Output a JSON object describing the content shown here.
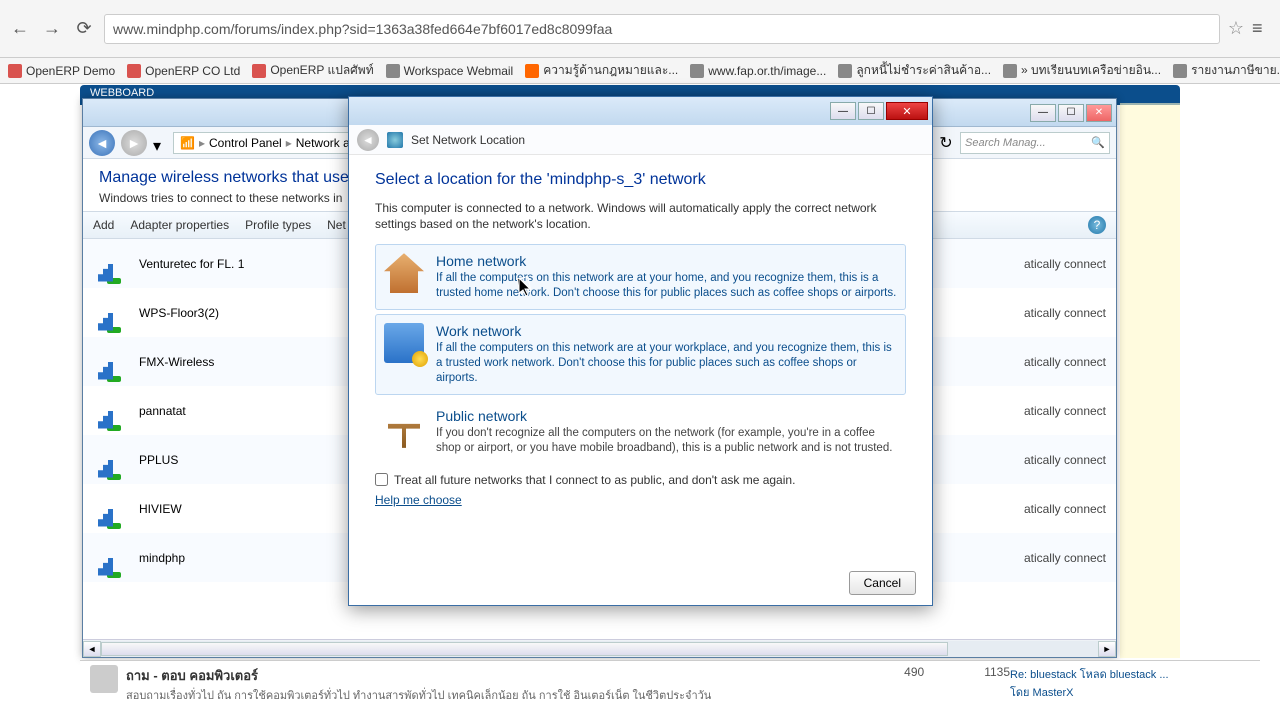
{
  "browser": {
    "url": "www.mindphp.com/forums/index.php?sid=1363a38fed664e7bf6017ed8c8099faa",
    "bookmarks": [
      {
        "label": "OpenERP Demo",
        "iconClass": "bm-red"
      },
      {
        "label": "OpenERP CO Ltd",
        "iconClass": "bm-red"
      },
      {
        "label": "OpenERP แปลศัพท์",
        "iconClass": "bm-red"
      },
      {
        "label": "Workspace Webmail",
        "iconClass": "bm-gray"
      },
      {
        "label": "ความรู้ด้านกฎหมายและ...",
        "iconClass": "bm-orange"
      },
      {
        "label": "www.fap.or.th/image...",
        "iconClass": "bm-gray"
      },
      {
        "label": "ลูกหนี้ไม่ชำระค่าสินค้าอ...",
        "iconClass": "bm-gray"
      },
      {
        "label": "» บทเรียนบทเครือข่ายอิน...",
        "iconClass": "bm-gray"
      },
      {
        "label": "รายงานภาษีขาย...ส่งออก",
        "iconClass": "bm-gray"
      }
    ]
  },
  "forum": {
    "bar": "WEBBOARD",
    "thread": {
      "title": "ถาม - ตอบ คอมพิวเตอร์",
      "sub": "สอบถามเรื่องทั่วไป ถัน การใช้คอมพิวเตอร์ทั่วไป ทำงานสารพัดทั่วไป เทคนิคเล็กน้อย ถัน การใช้ อินเตอร์เน็ต ในชีวิตประจำวัน",
      "stat1": "490",
      "stat2": "1135",
      "last_title": "Re: bluestack โหลด bluestack ...",
      "last_by": "โดย MasterX"
    }
  },
  "explorer": {
    "crumb1": "Control Panel",
    "crumb2": "Network and",
    "search_placeholder": "Search Manag...",
    "heading": "Manage wireless networks that use",
    "sub": "Windows tries to connect to these networks in",
    "toolbar": {
      "add": "Add",
      "adapter": "Adapter properties",
      "profile": "Profile types",
      "net": "Net"
    },
    "networks": [
      {
        "name": "Venturetec for FL. 1"
      },
      {
        "name": "WPS-Floor3(2)"
      },
      {
        "name": "FMX-Wireless"
      },
      {
        "name": "pannatat"
      },
      {
        "name": "PPLUS"
      },
      {
        "name": "HIVIEW"
      },
      {
        "name": "mindphp"
      }
    ],
    "right_text": "atically connect"
  },
  "dialog": {
    "title": "Set Network Location",
    "heading": "Select a location for the 'mindphp-s_3' network",
    "desc": "This computer is connected to a network. Windows will automatically apply the correct network settings based on the network's location.",
    "home": {
      "title": "Home network",
      "desc": "If all the computers on this network are at your home, and you recognize them, this is a trusted home network.  Don't choose this for public places such as coffee shops or airports."
    },
    "work": {
      "title": "Work network",
      "desc": "If all the computers on this network are at your workplace, and you recognize them, this is a trusted work network.  Don't choose this for public places such as coffee shops or airports."
    },
    "public": {
      "title": "Public network",
      "desc": "If you don't recognize all the computers on the network (for example, you're in a coffee shop or airport, or you have mobile broadband), this is a public network and is not trusted."
    },
    "checkbox": "Treat all future networks that I connect to as public, and don't ask me again.",
    "help": "Help me choose",
    "cancel": "Cancel"
  }
}
